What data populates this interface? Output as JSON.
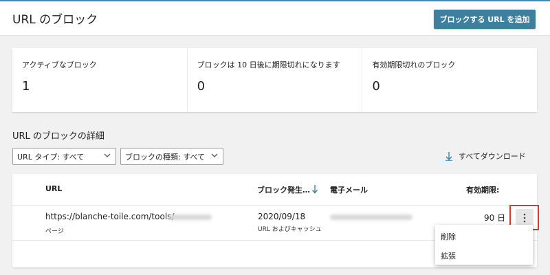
{
  "header": {
    "title": "URL のブロック",
    "add_button": "ブロックする URL を追加"
  },
  "stats": [
    {
      "label": "アクティブなブロック",
      "value": "1"
    },
    {
      "label": "ブロックは 10 日後に期限切れになります",
      "value": "0"
    },
    {
      "label": "有効期限切れのブロック",
      "value": "0"
    }
  ],
  "details": {
    "title": "URL のブロックの詳細",
    "filters": [
      {
        "label": "URL タイプ: すべて"
      },
      {
        "label": "ブロックの種類: すべて"
      }
    ],
    "download_label": "すべてダウンロード"
  },
  "table": {
    "columns": [
      "URL",
      "ブロック発生…",
      "電子メール",
      "有効期限:"
    ],
    "rows": [
      {
        "url": "https://blanche-toile.com/tools/",
        "url_type": "ページ",
        "date": "2020/09/18",
        "block_type": "URL およびキャッシュ",
        "expiry": "90 日"
      }
    ]
  },
  "row_menu": {
    "items": [
      "削除",
      "拡張"
    ]
  },
  "colors": {
    "accent": "#3f7f9e",
    "top_line": "#3e8cad",
    "highlight": "#d9382d"
  }
}
